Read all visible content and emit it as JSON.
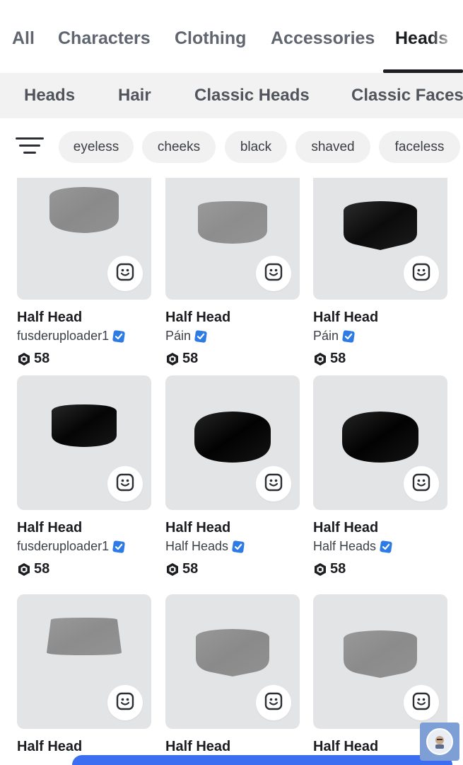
{
  "top_tabs": [
    "All",
    "Characters",
    "Clothing",
    "Accessories",
    "Heads"
  ],
  "active_top_tab": "Heads",
  "sub_tabs": [
    "Heads",
    "Hair",
    "Classic Heads",
    "Classic Faces"
  ],
  "filter": {
    "icon": "filter-lines-icon"
  },
  "chips": [
    "eyeless",
    "cheeks",
    "black",
    "shaved",
    "faceless"
  ],
  "items": [
    {
      "name": "Half Head",
      "creator": "fusderuploader1",
      "verified": true,
      "price": "58",
      "color": "#8a8a8a"
    },
    {
      "name": "Half Head",
      "creator": "Páin",
      "verified": true,
      "price": "58",
      "color": "#8d8d8d"
    },
    {
      "name": "Half Head",
      "creator": "Páin",
      "verified": true,
      "price": "58",
      "color": "#0b0b0b"
    },
    {
      "name": "Half Head",
      "creator": "fusderuploader1",
      "verified": true,
      "price": "58",
      "color": "#050505"
    },
    {
      "name": "Half Head",
      "creator": "Half Heads",
      "verified": true,
      "price": "58",
      "color": "#020202"
    },
    {
      "name": "Half Head",
      "creator": "Half Heads",
      "verified": true,
      "price": "58",
      "color": "#020202"
    },
    {
      "name": "Half Head",
      "creator": "",
      "verified": false,
      "price": "",
      "color": "#8c8c8c"
    },
    {
      "name": "Half Head",
      "creator": "",
      "verified": false,
      "price": "",
      "color": "#8a8a8a"
    },
    {
      "name": "Half Head",
      "creator": "",
      "verified": false,
      "price": "",
      "color": "#8b8b8b"
    }
  ],
  "icons": {
    "try_on": "smiley-face-icon",
    "verified": "verified-check-icon",
    "currency": "robux-icon"
  },
  "colors": {
    "accent": "#3c6ef2",
    "card_bg": "#e3e4e6",
    "verified": "#2f7be5"
  }
}
